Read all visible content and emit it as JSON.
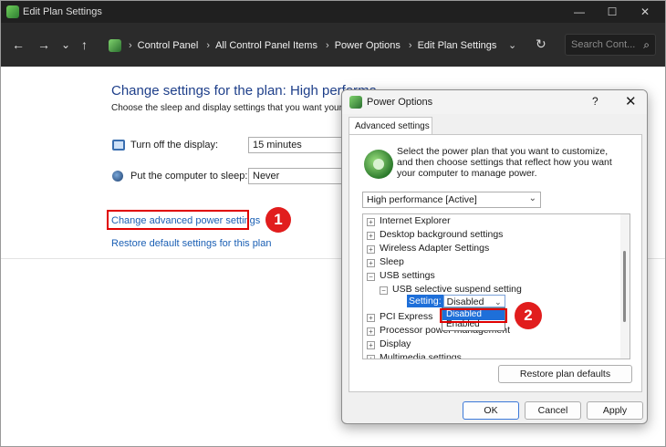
{
  "window": {
    "title": "Edit Plan Settings",
    "controls": {
      "minimize": "—",
      "maximize": "☐",
      "close": "✕"
    }
  },
  "addressbar": {
    "back": "←",
    "forward": "→",
    "recent": "⌄",
    "up": "↑",
    "breadcrumbs": [
      "Control Panel",
      "All Control Panel Items",
      "Power Options",
      "Edit Plan Settings"
    ],
    "separator": "›",
    "dropdown": "⌄",
    "refresh": "↻",
    "search_placeholder": "Search Cont...",
    "search_icon": "⌕"
  },
  "main": {
    "title": "Change settings for the plan: High performa",
    "subtitle": "Choose the sleep and display settings that you want your",
    "display": {
      "label": "Turn off the display:",
      "value": "15 minutes"
    },
    "sleep": {
      "label": "Put the computer to sleep:",
      "value": "Never"
    },
    "advanced_link": "Change advanced power settings",
    "restore_link": "Restore default settings for this plan"
  },
  "badges": {
    "step1": "1",
    "step2": "2"
  },
  "dialog": {
    "title": "Power Options",
    "help": "?",
    "close": "✕",
    "tab": "Advanced settings",
    "description": "Select the power plan that you want to customize, and then choose settings that reflect how you want your computer to manage power.",
    "plan_select": "High performance [Active]",
    "chevron": "⌄",
    "tree": [
      {
        "exp": "+",
        "label": "Internet Explorer"
      },
      {
        "exp": "+",
        "label": "Desktop background settings"
      },
      {
        "exp": "+",
        "label": "Wireless Adapter Settings"
      },
      {
        "exp": "+",
        "label": "Sleep"
      },
      {
        "exp": "−",
        "label": "USB settings"
      },
      {
        "exp": "−",
        "label": "USB selective suspend setting"
      },
      {
        "exp": "+",
        "label": "PCI Express"
      },
      {
        "exp": "+",
        "label": "Processor power management"
      },
      {
        "exp": "+",
        "label": "Display"
      },
      {
        "exp": "+",
        "label": "Multimedia settings"
      }
    ],
    "setting": {
      "label": "Setting:",
      "value": "Disabled"
    },
    "dropdown_options": [
      "Disabled",
      "Enabled"
    ],
    "restore_button": "Restore plan defaults",
    "ok_button": "OK",
    "cancel_button": "Cancel",
    "apply_button": "Apply"
  }
}
